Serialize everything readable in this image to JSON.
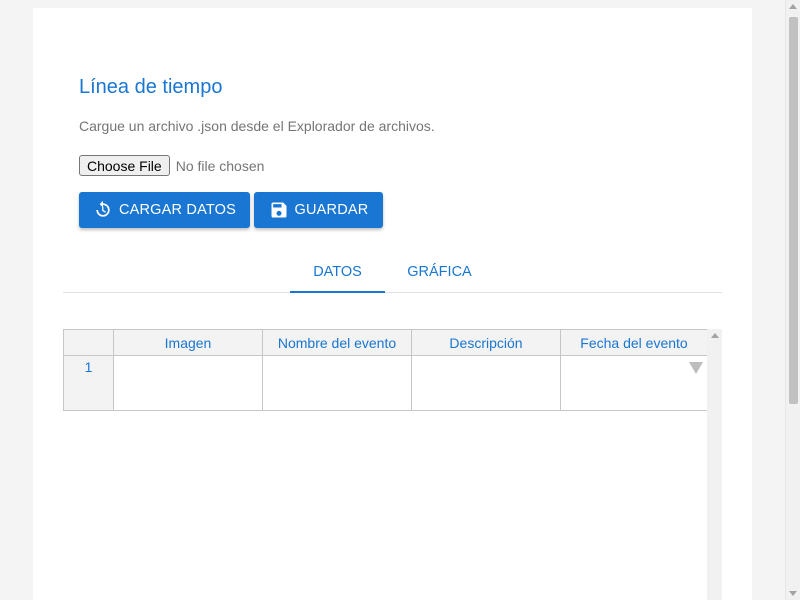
{
  "header": {
    "title": "Línea de tiempo",
    "subtitle": "Cargue un archivo .json desde el Explorador de archivos."
  },
  "file_input": {
    "button_label": "Choose File",
    "status": "No file chosen"
  },
  "actions": {
    "load_label": "CARGAR DATOS",
    "load_icon": "reload-icon",
    "save_label": "GUARDAR",
    "save_icon": "save-icon"
  },
  "tabs": [
    {
      "label": "DATOS",
      "active": true
    },
    {
      "label": "GRÁFICA",
      "active": false
    }
  ],
  "grid": {
    "columns": [
      "Imagen",
      "Nombre del evento",
      "Descripción",
      "Fecha del evento"
    ],
    "rows": [
      {
        "number": "1",
        "cells": [
          "",
          "",
          "",
          ""
        ]
      }
    ]
  },
  "colors": {
    "primary": "#1976d2",
    "muted_text": "#757575",
    "background": "#f4f4f4"
  }
}
